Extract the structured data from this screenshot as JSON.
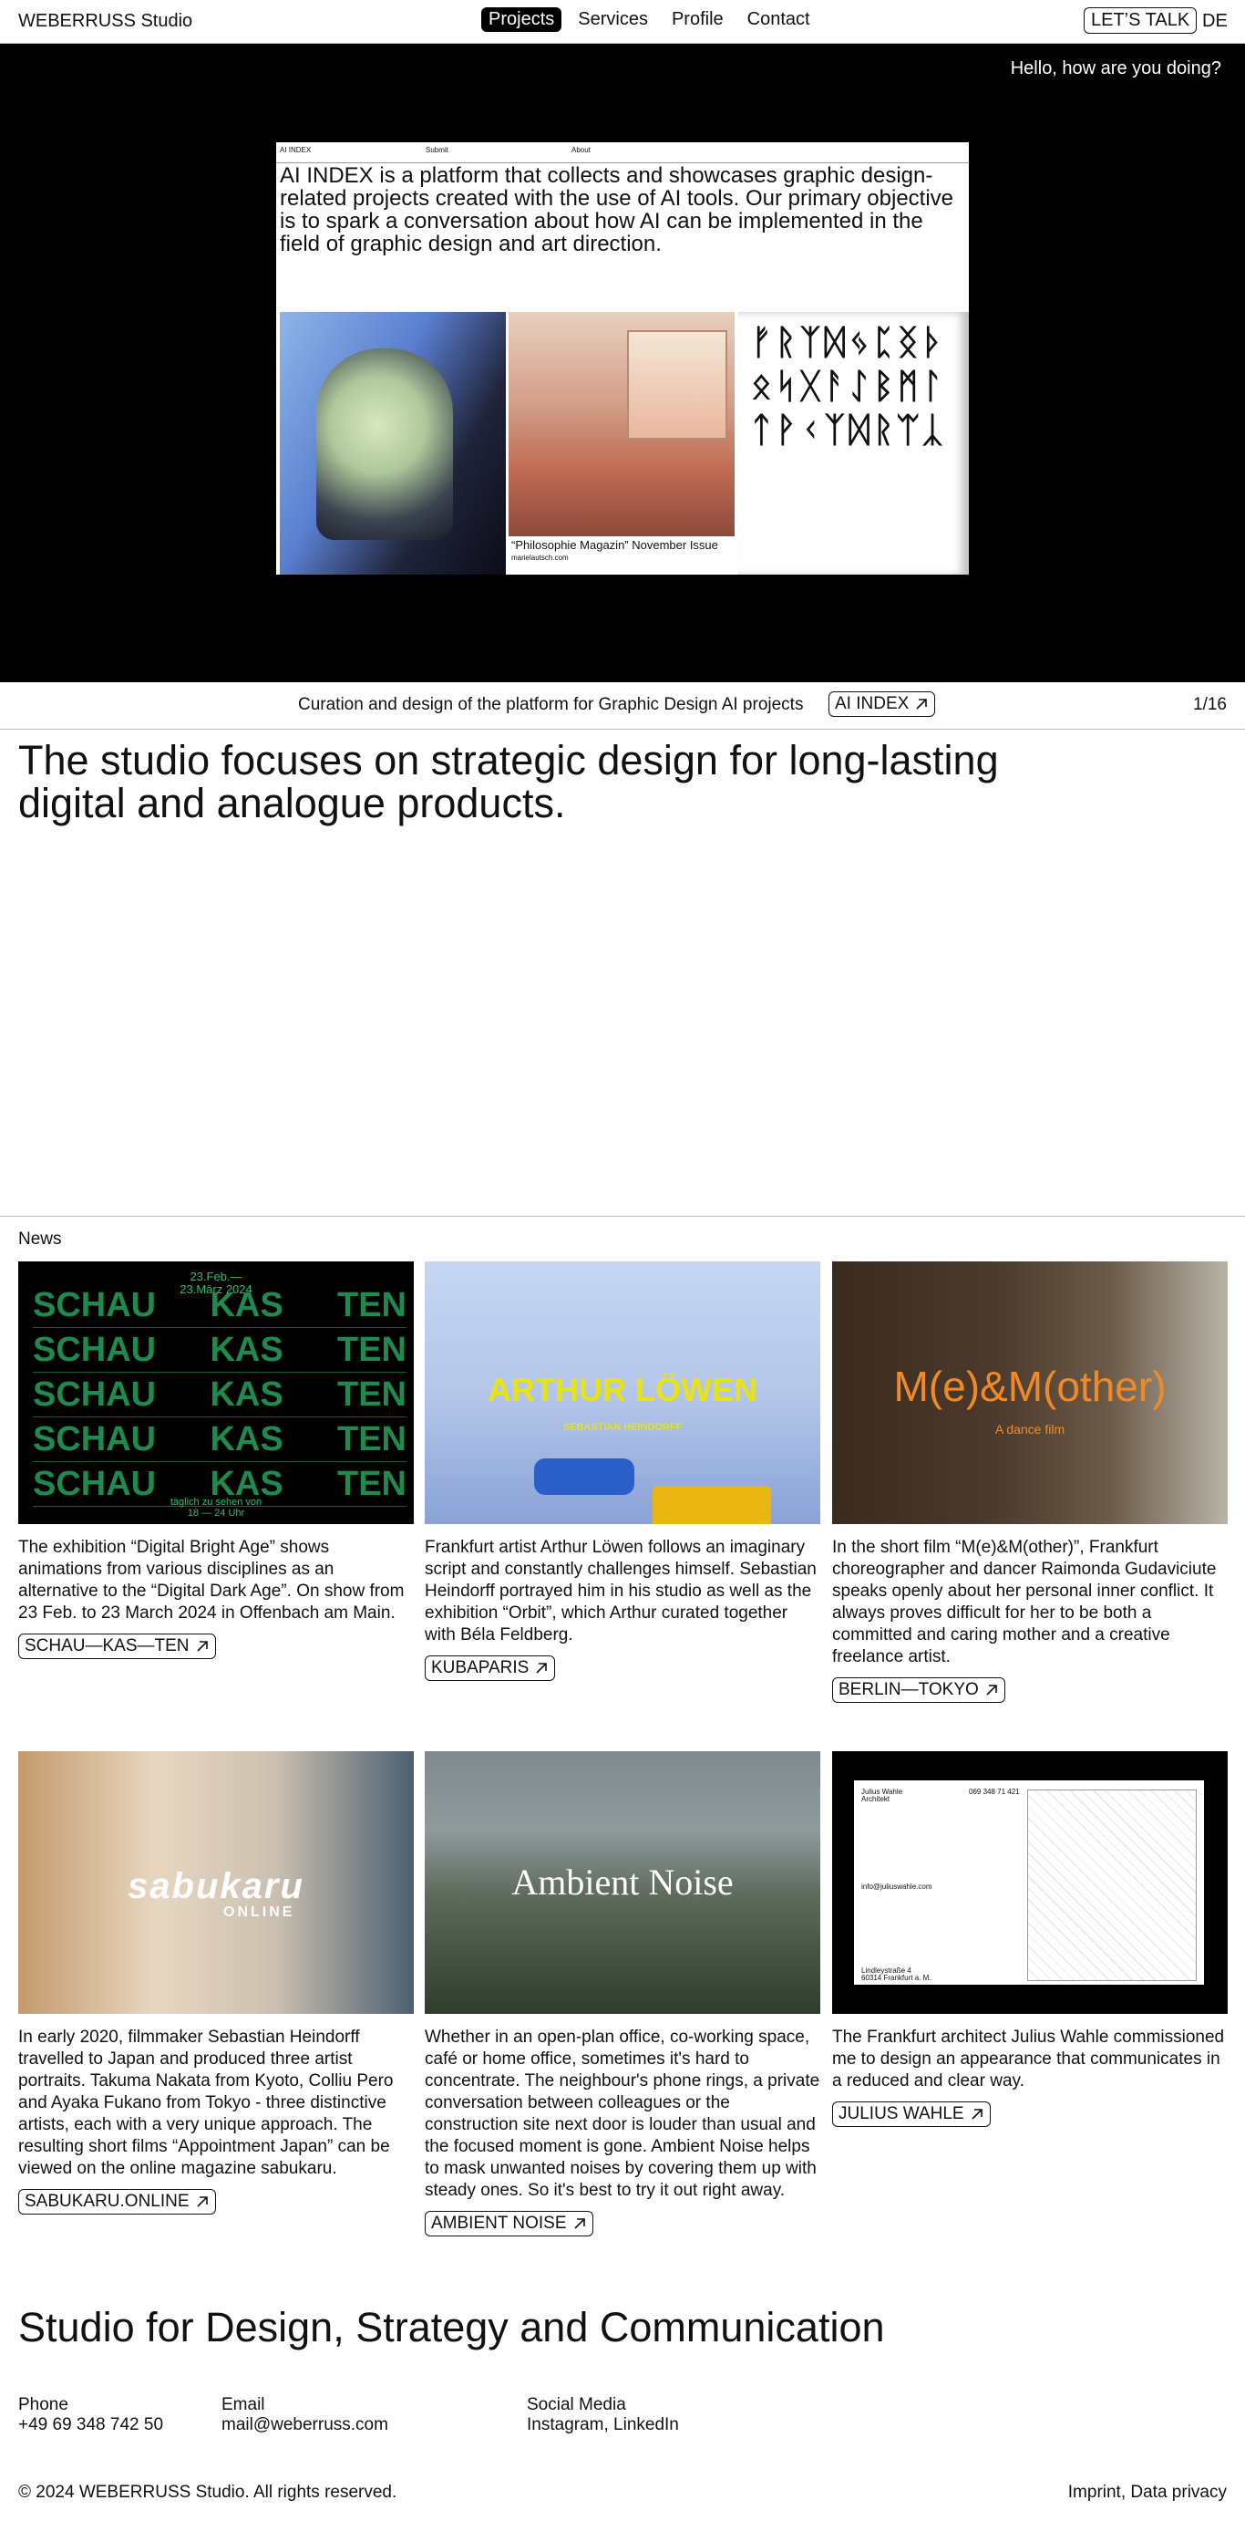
{
  "header": {
    "brand": "WEBERRUSS Studio",
    "nav": [
      "Projects",
      "Services",
      "Profile",
      "Contact"
    ],
    "cta": "LET’S TALK",
    "lang": "DE"
  },
  "hero": {
    "greeting": "Hello, how are you doing?",
    "preview": {
      "nav": [
        "AI INDEX",
        "Submit",
        "About"
      ],
      "text": "AI INDEX is a platform that collects and showcases graphic design-related projects created with the use of AI tools. Our primary objective is to spark a conversation about how AI can be implemented in the field of graphic design and art direction.",
      "caption": "“Philosophie Magazin” November Issue",
      "caption_small": "marielautsch.com",
      "glyphs": "ᚠᚱᛉᛞᛃᛈᛝᚦᛟᛋᚷᚨᛇᛒᛗᛚᛏᚹᚲᛉᛞᚱᛠᛣ"
    },
    "caption": "Curation and design of the platform for Graphic Design AI projects",
    "tag": "AI INDEX",
    "counter": "1/16"
  },
  "intro": "The studio focuses on strategic design for long-lasting digital and analogue products.",
  "news": {
    "label": "News",
    "items": [
      {
        "text": "The exhibition “Digital Bright Age” shows animations from various disciplines as an alternative to the “Digital Dark Age”. On show from 23 Feb. to 23 March 2024 in Offenbach am Main.",
        "tag": "SCHAU—KAS—TEN",
        "art": {
          "date": "23.Feb.—\n23.März 2024",
          "cols": [
            "SCHAU",
            "KAS",
            "TEN"
          ],
          "bottom": "täglich zu sehen von\n18 — 24 Uhr"
        }
      },
      {
        "text": "Frankfurt artist Arthur Löwen follows an imaginary script and constantly challenges himself. Sebastian Heindorff portrayed him in his studio as well as the exhibition “Orbit”, which Arthur curated together with Béla Feldberg.",
        "tag": "KUBAPARIS",
        "art": {
          "title": "ARTHUR LÖWEN",
          "sub": "SEBASTIAN HEINDORFF"
        }
      },
      {
        "text": "In the short film “M(e)&M(other)”, Frankfurt choreographer and dancer Raimonda Gudaviciute speaks openly about her personal inner conflict. It always proves difficult for her to be both a committed and caring mother and a creative freelance artist.",
        "tag": "BERLIN—TOKYO",
        "art": {
          "title": "M(e)&M(other)",
          "sub": "A dance film"
        }
      },
      {
        "text": "In early 2020, filmmaker Sebastian Heindorff travelled to Japan and produced three artist portraits. Takuma Nakata from Kyoto, Colliu Pero and Ayaka Fukano from Tokyo - three distinctive artists, each with a very unique approach. The resulting short films “Appointment Japan” can be viewed on the online magazine sabukaru.",
        "tag": "SABUKARU.ONLINE",
        "art": {
          "title": "sabukaru",
          "sub": "ONLINE"
        }
      },
      {
        "text": "Whether in an open-plan office, co-working space, café or home office, sometimes it's hard to concentrate. The neighbour's phone rings, a private conversation between colleagues or the construction site next door is louder than usual and the focused moment is gone. Ambient Noise helps to mask unwanted noises by covering them up with steady ones. So it's best to try it out right away.",
        "tag": "AMBIENT NOISE",
        "art": {
          "title": "Ambient Noise"
        }
      },
      {
        "text": "The Frankfurt architect Julius Wahle commissioned me to design an appearance that communicates in a reduced and clear way.",
        "tag": "JULIUS WAHLE",
        "art": {
          "name": "Julius Wahle",
          "role": "Architekt",
          "phone": "069 348 71 421",
          "email": "info@juliuswahle.com",
          "addr1": "Lindleystraße 4",
          "addr2": "60314 Frankfurt a. M."
        }
      }
    ]
  },
  "footer": {
    "headline": "Studio for Design, Strategy and Communication",
    "phone_label": "Phone",
    "phone": "+49 69 348 742 50",
    "email_label": "Email",
    "email": "mail@weberruss.com",
    "social_label": "Social Media",
    "social": "Instagram, LinkedIn",
    "copyright": "© 2024 WEBERRUSS Studio. All rights reserved.",
    "legal": "Imprint, Data privacy"
  }
}
